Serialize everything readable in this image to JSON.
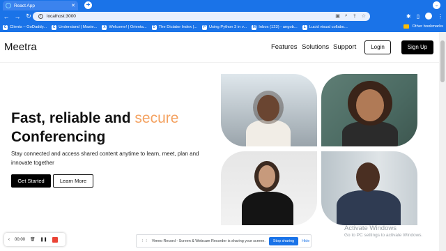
{
  "browser": {
    "tab_title": "React App",
    "url": "localhost:3000",
    "bookmarks": [
      {
        "icon": "C",
        "label": "Clients – GoDaddy..."
      },
      {
        "icon": "C",
        "label": "Understand | Maste..."
      },
      {
        "icon": "X",
        "label": "Welcome! | Orienta..."
      },
      {
        "icon": "D",
        "label": "The Dictator Index |..."
      },
      {
        "icon": "P",
        "label": "Using Python 3 in v..."
      },
      {
        "icon": "M",
        "label": "Inbox (123) - angob..."
      },
      {
        "icon": "L",
        "label": "Lucid visual collabo..."
      }
    ],
    "other_bookmarks": "Other bookmarks"
  },
  "nav": {
    "logo": "Meetra",
    "links": [
      "Features",
      "Solutions",
      "Support"
    ],
    "login": "Login",
    "signup": "Sign Up"
  },
  "hero": {
    "title_part1": "Fast, reliable and",
    "title_accent": "secure",
    "title_part2": "Conferencing",
    "description": "Stay connected and access shared content anytime to learn, meet, plan and innovate together",
    "cta_primary": "Get Started",
    "cta_secondary": "Learn More"
  },
  "overlay": {
    "recorder_time": "00:00",
    "share_message": "Vimeo Record - Screen & Webcam Recorder is sharing your screen.",
    "stop_sharing": "Stop sharing",
    "hide": "Hide",
    "watermark_title": "Activate Windows",
    "watermark_sub": "Go to PC settings to activate Windows."
  },
  "colors": {
    "accent": "#f4a261",
    "chrome": "#1a73e8"
  }
}
